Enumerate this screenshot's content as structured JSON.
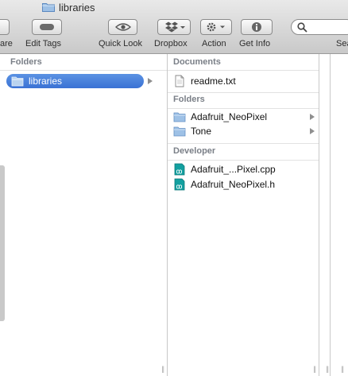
{
  "window": {
    "title": "libraries"
  },
  "toolbar": {
    "share_label": "are",
    "edit_tags_label": "Edit Tags",
    "quick_look_label": "Quick Look",
    "dropbox_label": "Dropbox",
    "action_label": "Action",
    "get_info_label": "Get Info",
    "search_label": "Sea"
  },
  "column1": {
    "section": "Folders",
    "items": [
      {
        "label": "libraries",
        "icon": "folder-icon",
        "selected": true
      }
    ]
  },
  "column2": {
    "documents": {
      "header": "Documents",
      "items": [
        {
          "label": "readme.txt",
          "icon": "text-file-icon"
        }
      ]
    },
    "folders": {
      "header": "Folders",
      "items": [
        {
          "label": "Adafruit_NeoPixel",
          "icon": "folder-icon"
        },
        {
          "label": "Tone",
          "icon": "folder-icon"
        }
      ]
    },
    "developer": {
      "header": "Developer",
      "items": [
        {
          "label": "Adafruit_...Pixel.cpp",
          "icon": "arduino-file-icon"
        },
        {
          "label": "Adafruit_NeoPixel.h",
          "icon": "arduino-file-icon"
        }
      ]
    }
  },
  "colors": {
    "selection": "#3a72d4",
    "folder": "#8fb4dd",
    "arduino": "#16a3a3"
  }
}
